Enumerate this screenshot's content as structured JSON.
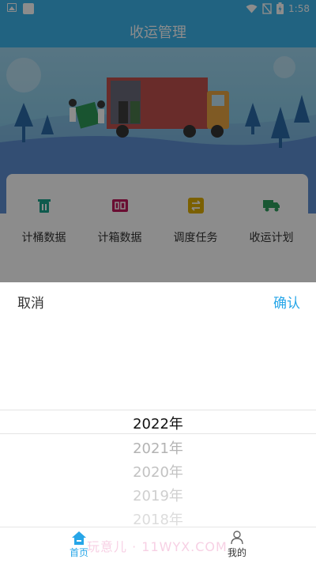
{
  "status_bar": {
    "time": "1:58"
  },
  "header": {
    "title": "收运管理"
  },
  "menu": {
    "items": [
      {
        "label": "计桶数据",
        "icon": "trash-bin-icon",
        "color": "#1aa58c"
      },
      {
        "label": "计箱数据",
        "icon": "box-counter-icon",
        "color": "#c2185b"
      },
      {
        "label": "调度任务",
        "icon": "dispatch-icon",
        "color": "#e0b000"
      },
      {
        "label": "收运计划",
        "icon": "truck-icon",
        "color": "#2e9e5e"
      }
    ]
  },
  "picker": {
    "cancel_label": "取消",
    "confirm_label": "确认",
    "options": [
      "2022年",
      "2021年",
      "2020年",
      "2019年",
      "2018年"
    ],
    "selected": "2022年"
  },
  "tabs": [
    {
      "label": "首页",
      "icon": "home-icon",
      "active": true
    },
    {
      "label": "我的",
      "icon": "user-icon",
      "active": false
    }
  ],
  "watermark": "玩意儿 · 11WYX.COM",
  "colors": {
    "brand": "#3db4ec",
    "accent": "#27a6e8"
  }
}
